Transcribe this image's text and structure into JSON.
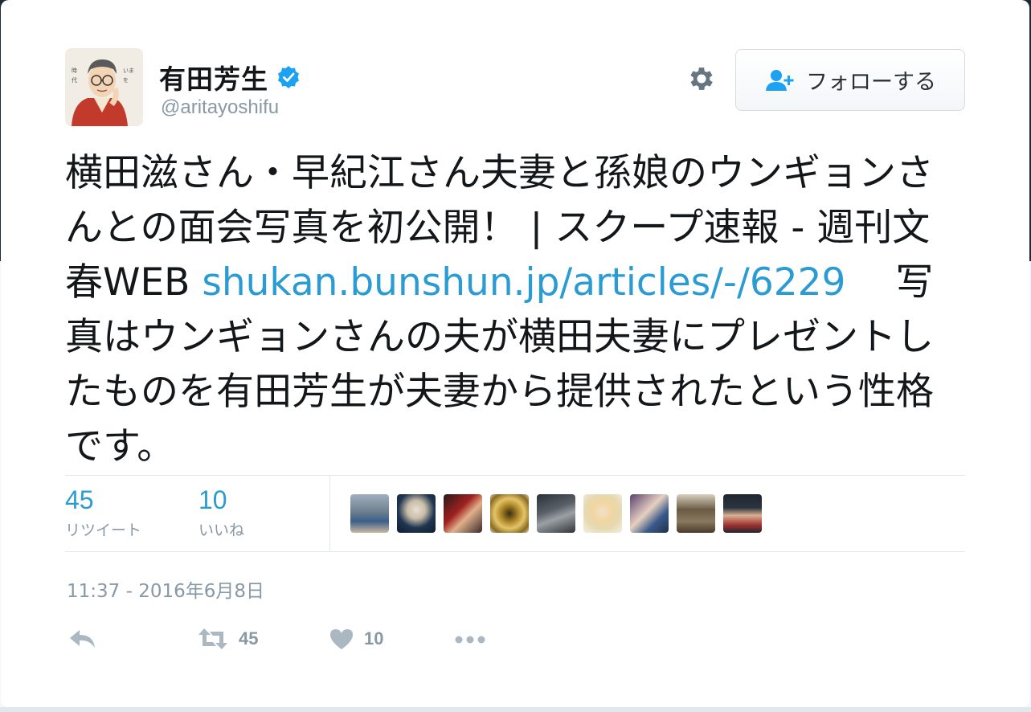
{
  "user": {
    "display_name": "有田芳生",
    "handle": "@aritayoshifu",
    "verified": true,
    "avatar_icon": "portrait-avatar"
  },
  "header": {
    "settings_icon": "gear-icon",
    "follow_label": "フォローする",
    "follow_icon": "add-user-icon"
  },
  "tweet": {
    "text_before_link": "横田滋さん・早紀江さん夫妻と孫娘のウンギョンさんとの面会写真を初公開！ | スクープ速報 - 週刊文春WEB ",
    "link_text": "shukan.bunshun.jp/articles/-/6229",
    "text_after_link": "　 写真はウンギョンさんの夫が横田夫妻にプレゼントしたものを有田芳生が夫妻から提供されたという性格です。"
  },
  "stats": {
    "retweets": {
      "count": "45",
      "label": "リツイート"
    },
    "likes": {
      "count": "10",
      "label": "いいね"
    }
  },
  "likers_count": 9,
  "timestamp": "11:37 - 2016年6月8日",
  "actions": {
    "reply_icon": "reply-icon",
    "retweet_icon": "retweet-icon",
    "retweet_count": "45",
    "like_icon": "heart-icon",
    "like_count": "10",
    "more_icon": "more-dots-icon"
  },
  "colors": {
    "link": "#2b9cd3",
    "muted": "#8899a6",
    "verified": "#1da1f2",
    "background_top": "#1e2a36"
  }
}
